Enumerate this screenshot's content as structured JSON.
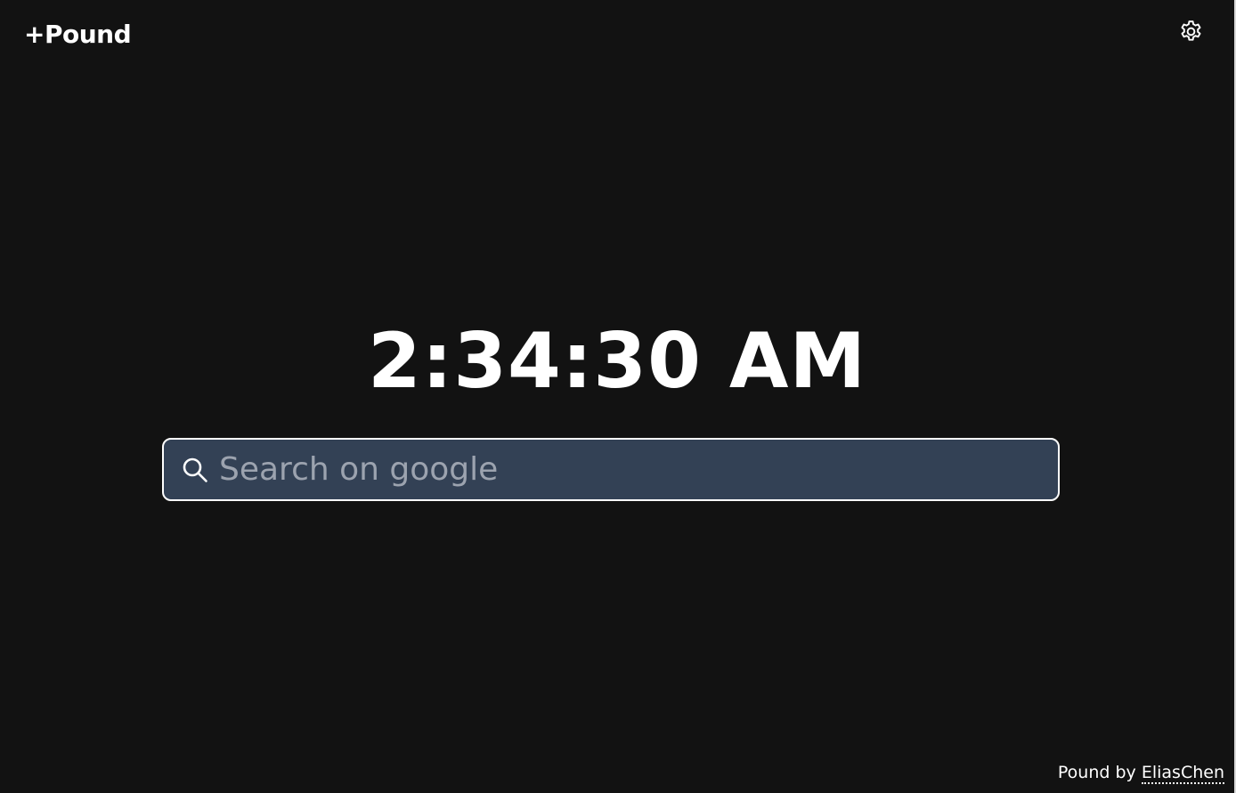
{
  "header": {
    "logo_text": "+Pound",
    "settings_icon": "gear-icon"
  },
  "clock": {
    "time": "2:34:30 AM"
  },
  "search": {
    "placeholder": "Search on google",
    "value": "",
    "icon": "search-icon"
  },
  "footer": {
    "prefix": "Pound by ",
    "author_link": "EliasChen"
  },
  "colors": {
    "background": "#121212",
    "search_background": "#334155",
    "text": "#ffffff",
    "placeholder": "#9ca3af"
  }
}
